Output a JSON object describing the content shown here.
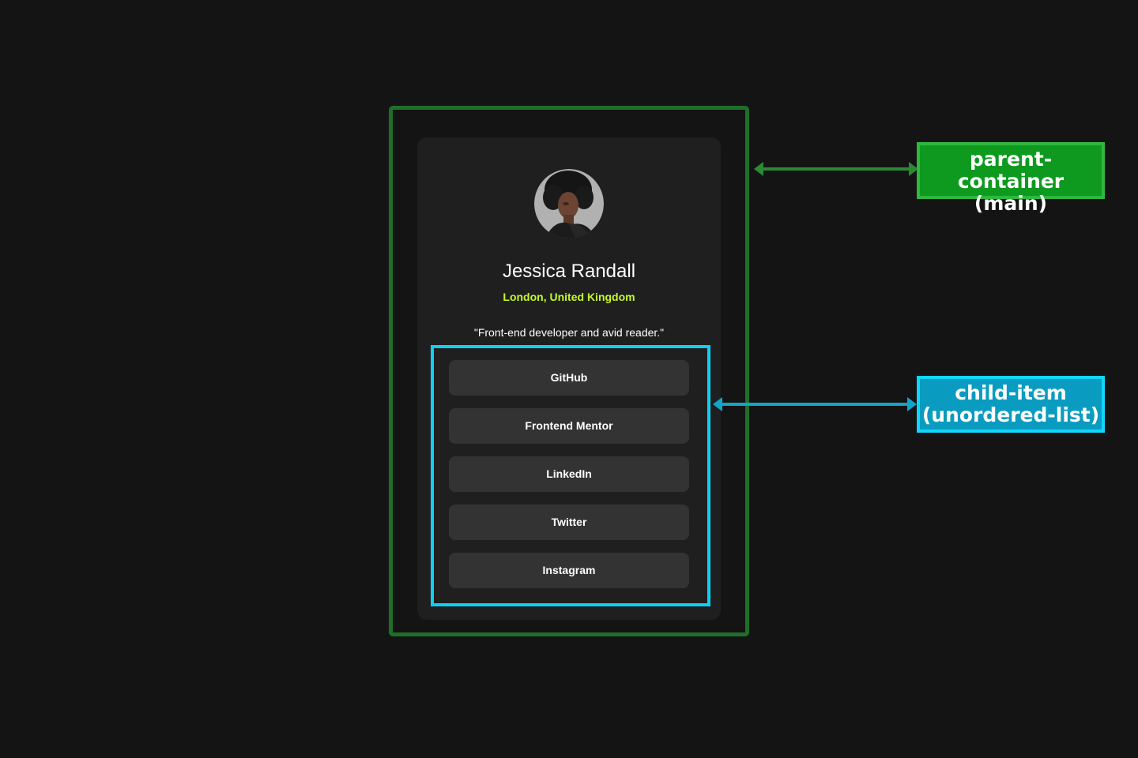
{
  "profile": {
    "name": "Jessica Randall",
    "location": "London, United Kingdom",
    "bio": "\"Front-end developer and avid reader.\""
  },
  "links": [
    {
      "label": "GitHub"
    },
    {
      "label": "Frontend Mentor"
    },
    {
      "label": "LinkedIn"
    },
    {
      "label": "Twitter"
    },
    {
      "label": "Instagram"
    }
  ],
  "annotations": {
    "parent": {
      "line1": "parent-container",
      "line2": "(main)",
      "color": "#0e9a1f"
    },
    "child": {
      "line1": "child-item",
      "line2": "(unordered-list)",
      "color": "#0a9cc0"
    }
  },
  "colors": {
    "background": "#141414",
    "card": "#1f1f1f",
    "button": "#333333",
    "accent": "#c4f82a",
    "parent_outline": "#1f6e2a",
    "child_outline": "#0ed0f4"
  }
}
